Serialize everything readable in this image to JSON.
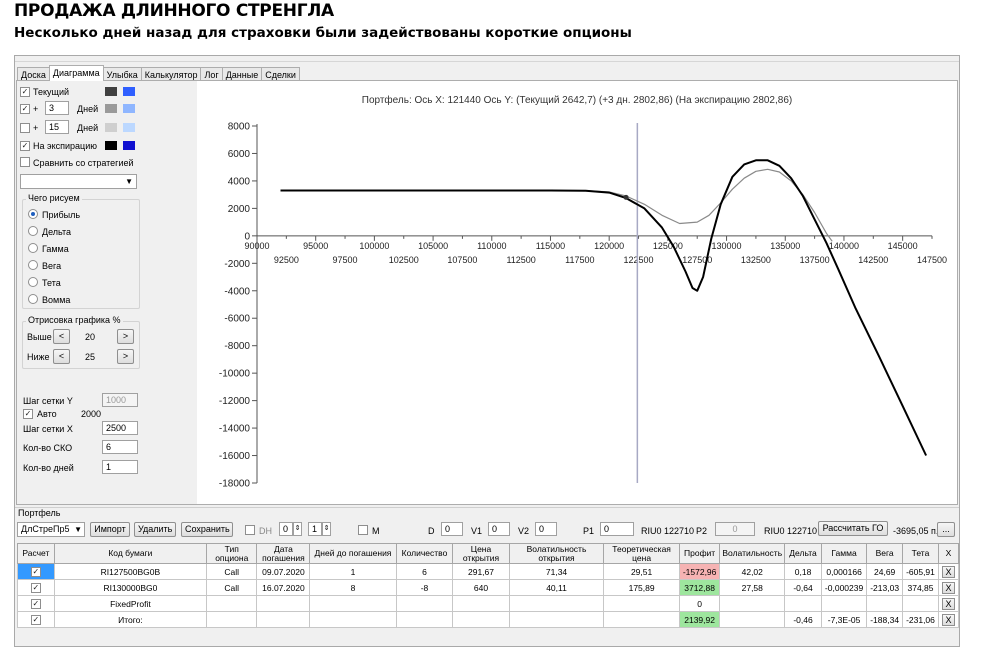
{
  "header": {
    "title": "ПРОДАЖА ДЛИННОГО СТРЕНГЛА",
    "subtitle": "Несколько дней назад для страховки были задействованы короткие опционы"
  },
  "tabs": [
    "Доска",
    "Диаграмма",
    "Улыбка",
    "Калькулятор",
    "Лог",
    "Данные",
    "Сделки"
  ],
  "left_panel": {
    "current_label": "Текущий",
    "plus": "+",
    "days_label": "Дней",
    "days1": "3",
    "days2": "15",
    "expiry_label": "На экспирацию",
    "compare_label": "Сравнить со стратегией",
    "group_title": "Чего рисуем",
    "radios": [
      "Прибыль",
      "Дельта",
      "Гамма",
      "Вега",
      "Тета",
      "Вомма"
    ],
    "draw_title": "Отрисовка графика %",
    "above_label": "Выше",
    "above_value": "20",
    "below_label": "Ниже",
    "below_value": "25",
    "lt": "<",
    "gt": ">",
    "grid_y_label": "Шаг сетки Y",
    "grid_y_value": "1000",
    "auto_label": "Авто",
    "auto_value": "2000",
    "grid_x_label": "Шаг сетки X",
    "grid_x_value": "2500",
    "sko_label": "Кол-во СКО",
    "sko_value": "6",
    "days_count_label": "Кол-во дней",
    "days_count_value": "1"
  },
  "colors": {
    "current_swatch1": "#404040",
    "current_swatch2": "#2f5fff",
    "plus3_swatch1": "#9a9a9a",
    "plus3_swatch2": "#8fb6ff",
    "plus15_swatch1": "#cfcfcf",
    "plus15_swatch2": "#bcd8ff",
    "expiry_swatch1": "#000000",
    "expiry_swatch2": "#1010d0"
  },
  "chart_data": {
    "type": "line",
    "title": "Портфель: Ось X: 121440 Ось Y:  (Текущий 2642,7)  (+3 дн. 2802,86)  (На экспирацию 2802,86)",
    "xlim": [
      90000,
      147500
    ],
    "ylim": [
      -18000,
      8000
    ],
    "y_ticks": [
      8000,
      6000,
      4000,
      2000,
      0,
      -2000,
      -4000,
      -6000,
      -8000,
      -10000,
      -12000,
      -14000,
      -16000,
      -18000
    ],
    "x_ticks_top": [
      90000,
      95000,
      100000,
      105000,
      110000,
      115000,
      120000,
      125000,
      130000,
      135000,
      140000,
      145000
    ],
    "x_ticks_bottom": [
      92500,
      97500,
      102500,
      107500,
      112500,
      117500,
      122500,
      127500,
      132500,
      137500,
      142500,
      147500
    ],
    "cursor_x": 122400,
    "marker": {
      "x": 121440,
      "y": 2800
    },
    "series": [
      {
        "color": "#000000",
        "x": [
          92000,
          100000,
          110000,
          115000,
          118000,
          120000,
          121440,
          123000,
          124500,
          125500,
          126500,
          127100,
          127500,
          128000,
          128700,
          129500,
          130500,
          131500,
          132500,
          133500,
          134500,
          135500,
          136500,
          137500,
          138500,
          139500,
          141000,
          143000,
          145000,
          147000
        ],
        "y": [
          3300,
          3300,
          3300,
          3300,
          3280,
          3150,
          2750,
          2000,
          600,
          -800,
          -2600,
          -3800,
          -4000,
          -3000,
          -200,
          2300,
          4300,
          5200,
          5500,
          5500,
          5100,
          4200,
          2900,
          1200,
          -500,
          -2400,
          -5300,
          -8800,
          -12400,
          -16000
        ]
      },
      {
        "color": "#8a8a8a",
        "x": [
          92000,
          100000,
          110000,
          115000,
          118000,
          120000,
          121440,
          123000,
          124500,
          126000,
          127500,
          128500,
          129500,
          130500,
          131500,
          132500,
          133500,
          134500,
          135500,
          136500,
          137500,
          138500,
          139000
        ],
        "y": [
          3300,
          3300,
          3300,
          3300,
          3290,
          3200,
          2900,
          2300,
          1500,
          900,
          1000,
          1500,
          2400,
          3400,
          4200,
          4700,
          4850,
          4650,
          4000,
          3000,
          1700,
          200,
          -400
        ]
      }
    ]
  },
  "portfolio": {
    "section_label": "Портфель",
    "select_value": "ДлСтреПр5",
    "import_btn": "Импорт",
    "delete_btn": "Удалить",
    "save_btn": "Сохранить",
    "dh_label": "DH",
    "spin1": "0",
    "spin2": "1",
    "m_label": "M",
    "d_label": "D",
    "d_value": "0",
    "v1_label": "V1",
    "v1_value": "0",
    "v2_label": "V2",
    "v2_value": "0",
    "p1_label": "P1",
    "p1_value": "0",
    "riu1": "RIU0 122710",
    "p2_label": "P2",
    "p2_value": "0",
    "riu2": "RIU0 122710",
    "calc_btn": "Рассчитать ГО",
    "go_value": "-3695,05 п.",
    "more_btn": "..."
  },
  "table": {
    "headers": [
      "Расчет",
      "Код бумаги",
      "Тип опциона",
      "Дата погашения",
      "Дней до погашения",
      "Количество",
      "Цена открытия",
      "Волатильность открытия",
      "Теоретическая цена",
      "Профит",
      "Волатильность",
      "Дельта",
      "Гамма",
      "Вега",
      "Тета",
      "X"
    ],
    "rows": [
      [
        "✓",
        "RI127500BG0B",
        "Call",
        "09.07.2020",
        "1",
        "6",
        "291,67",
        "71,34",
        "29,51",
        "-1572,96",
        "42,02",
        "0,18",
        "0,000166",
        "24,69",
        "-605,91",
        "X"
      ],
      [
        "✓",
        "RI130000BG0",
        "Call",
        "16.07.2020",
        "8",
        "-8",
        "640",
        "40,11",
        "175,89",
        "3712,88",
        "27,58",
        "-0,64",
        "-0,000239",
        "-213,03",
        "374,85",
        "X"
      ],
      [
        "✓",
        "FixedProfit",
        "",
        "",
        "",
        "",
        "",
        "",
        "",
        "0",
        "",
        "",
        "",
        "",
        "",
        "X"
      ],
      [
        "✓",
        "Итого:",
        "",
        "",
        "",
        "",
        "",
        "",
        "",
        "2139,92",
        "",
        "-0,46",
        "-7,3E-05",
        "-188,34",
        "-231,06",
        "X"
      ]
    ]
  }
}
